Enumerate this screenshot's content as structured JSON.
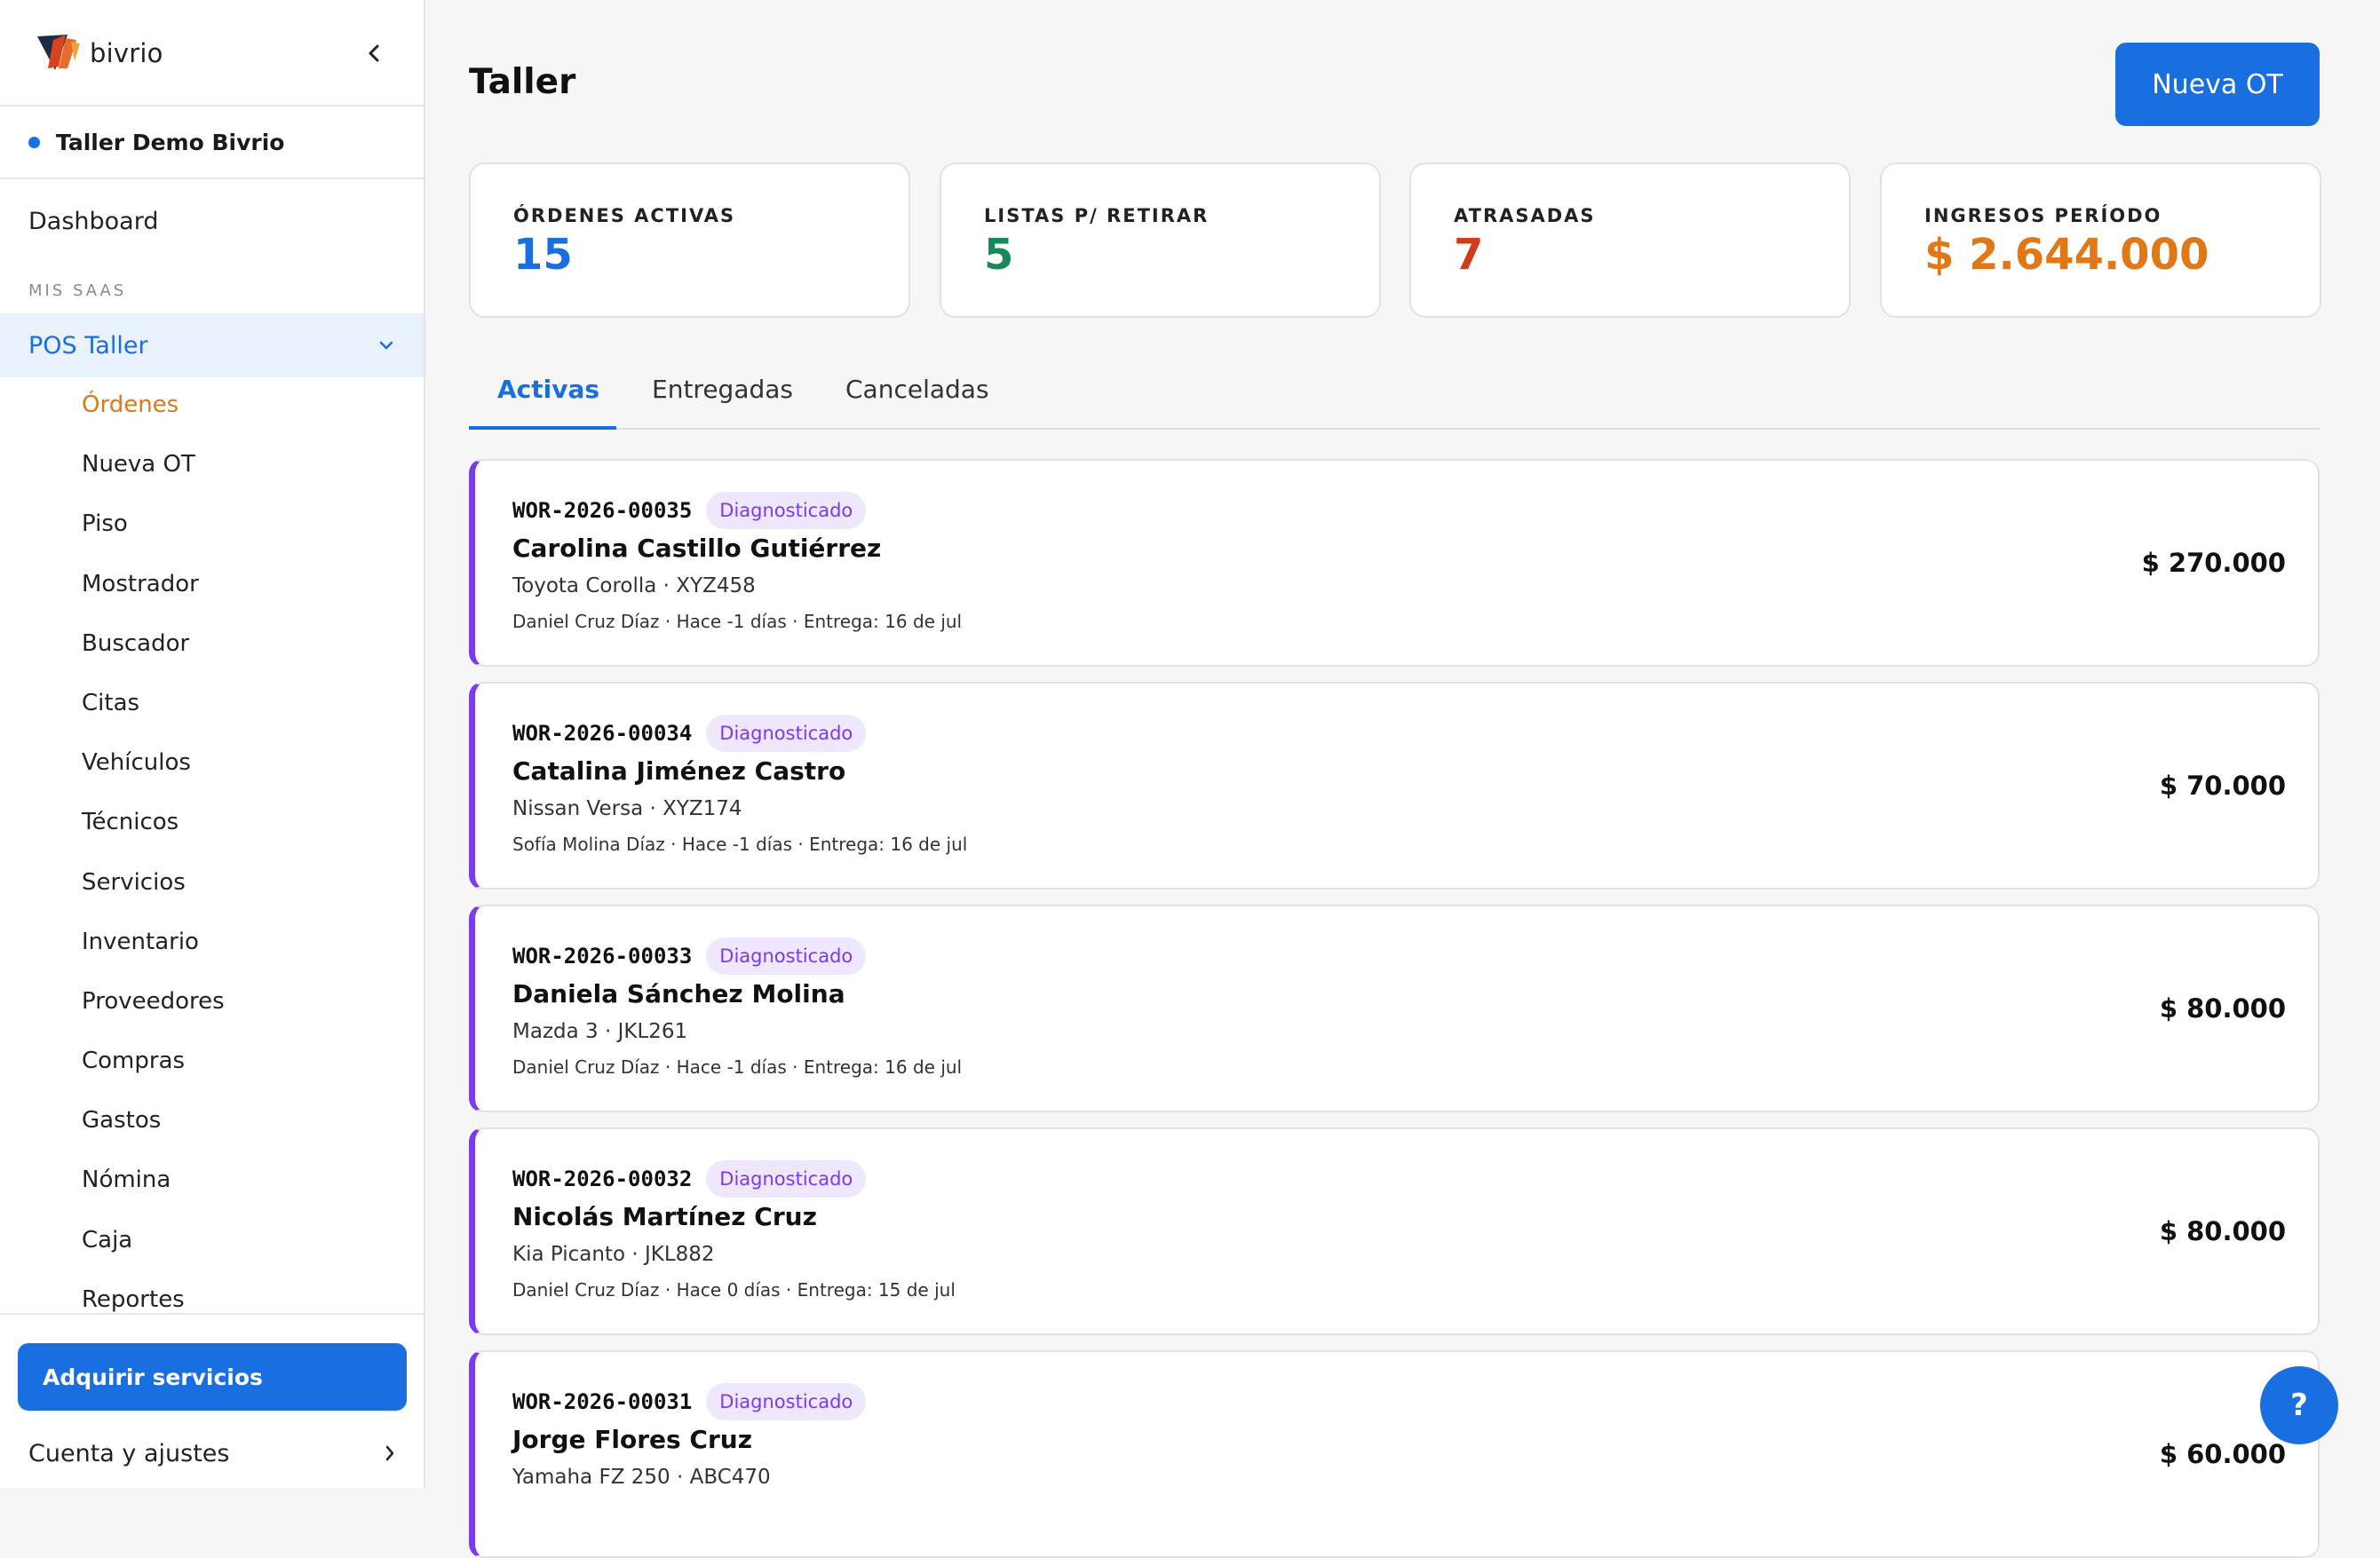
{
  "brand": {
    "name": "bivrio"
  },
  "org": {
    "name": "Taller Demo Bivrio"
  },
  "nav": {
    "dashboard": "Dashboard",
    "section_label": "MIS SAAS",
    "pos_label": "POS Taller",
    "sub_items": [
      {
        "label": "Órdenes",
        "active": true
      },
      {
        "label": "Nueva OT"
      },
      {
        "label": "Piso"
      },
      {
        "label": "Mostrador"
      },
      {
        "label": "Buscador"
      },
      {
        "label": "Citas"
      },
      {
        "label": "Vehículos"
      },
      {
        "label": "Técnicos"
      },
      {
        "label": "Servicios"
      },
      {
        "label": "Inventario"
      },
      {
        "label": "Proveedores"
      },
      {
        "label": "Compras"
      },
      {
        "label": "Gastos"
      },
      {
        "label": "Nómina"
      },
      {
        "label": "Caja"
      },
      {
        "label": "Reportes"
      }
    ],
    "cta": "Adquirir servicios",
    "account": "Cuenta y ajustes"
  },
  "header": {
    "title": "Taller",
    "new_button": "Nueva OT"
  },
  "stats": [
    {
      "label": "ÓRDENES ACTIVAS",
      "value": "15",
      "color": "#1a6fe0"
    },
    {
      "label": "LISTAS P/ RETIRAR",
      "value": "5",
      "color": "#16895a"
    },
    {
      "label": "ATRASADAS",
      "value": "7",
      "color": "#d23a1e"
    },
    {
      "label": "INGRESOS PERÍODO",
      "value": "$ 2.644.000",
      "color": "#e07818"
    }
  ],
  "tabs": [
    {
      "label": "Activas",
      "active": true
    },
    {
      "label": "Entregadas"
    },
    {
      "label": "Canceladas"
    }
  ],
  "orders": [
    {
      "code": "WOR-2026-00035",
      "status": "Diagnosticado",
      "customer": "Carolina Castillo Gutiérrez",
      "vehicle": "Toyota Corolla · XYZ458",
      "meta": "Daniel Cruz Díaz · Hace -1 días · Entrega: 16 de jul",
      "amount": "$ 270.000"
    },
    {
      "code": "WOR-2026-00034",
      "status": "Diagnosticado",
      "customer": "Catalina Jiménez Castro",
      "vehicle": "Nissan Versa · XYZ174",
      "meta": "Sofía Molina Díaz · Hace -1 días · Entrega: 16 de jul",
      "amount": "$ 70.000"
    },
    {
      "code": "WOR-2026-00033",
      "status": "Diagnosticado",
      "customer": "Daniela Sánchez Molina",
      "vehicle": "Mazda 3 · JKL261",
      "meta": "Daniel Cruz Díaz · Hace -1 días · Entrega: 16 de jul",
      "amount": "$ 80.000"
    },
    {
      "code": "WOR-2026-00032",
      "status": "Diagnosticado",
      "customer": "Nicolás Martínez Cruz",
      "vehicle": "Kia Picanto · JKL882",
      "meta": "Daniel Cruz Díaz · Hace 0 días · Entrega: 15 de jul",
      "amount": "$ 80.000"
    },
    {
      "code": "WOR-2026-00031",
      "status": "Diagnosticado",
      "customer": "Jorge Flores Cruz",
      "vehicle": "Yamaha FZ 250 · ABC470",
      "meta": "",
      "amount": "$ 60.000"
    }
  ],
  "help": {
    "label": "?"
  }
}
